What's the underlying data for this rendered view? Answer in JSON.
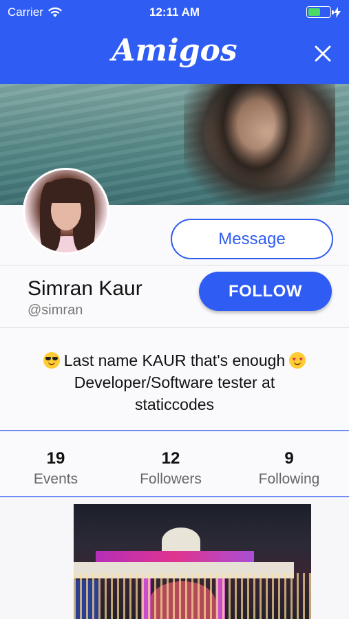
{
  "status_bar": {
    "carrier": "Carrier",
    "time": "12:11 AM",
    "battery_level": 0.55,
    "battery_color": "#4cd964"
  },
  "nav": {
    "title": "Amigos",
    "close_icon": "close-icon",
    "background": "#2f5cf2"
  },
  "profile": {
    "message_label": "Message",
    "follow_label": "FOLLOW",
    "name": "Simran Kaur",
    "handle": "@simran"
  },
  "bio": {
    "line1": "Last name KAUR that's enough",
    "line1_leading_emoji": "smiling-face-with-sunglasses",
    "line1_trailing_emoji": "heart-eyes",
    "line2": "Developer/Software tester at",
    "line3": "staticcodes"
  },
  "stats": [
    {
      "value": "19",
      "label": "Events"
    },
    {
      "value": "12",
      "label": "Followers"
    },
    {
      "value": "9",
      "label": "Following"
    }
  ],
  "colors": {
    "accent": "#2f5cf2",
    "divider_accent": "#6f8cf5"
  }
}
